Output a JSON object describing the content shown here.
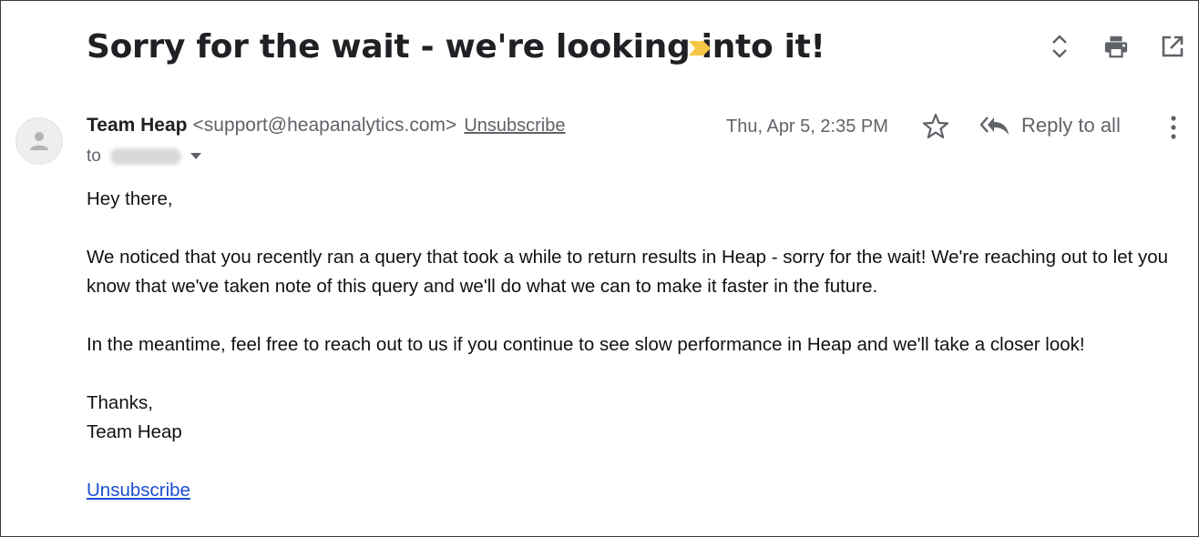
{
  "email": {
    "subject": "Sorry for the wait - we're looking into it!",
    "importance_marker_color": "#f6c744",
    "sender": {
      "name": "Team Heap",
      "email": "<support@heapanalytics.com>",
      "unsubscribe_label": "Unsubscribe"
    },
    "to_label": "to",
    "date": "Thu, Apr 5, 2:35 PM",
    "reply_all_label": "Reply to all",
    "body": {
      "greeting": "Hey there,",
      "paragraph1": "We noticed that you recently ran a query that took a while to return results in Heap - sorry for the wait! We're reaching out to let you know that we've taken note of this query and we'll do what we can to make it faster in the future.",
      "paragraph2": "In the meantime, feel free to reach out to us if you continue to see slow performance in Heap and we'll take a closer look!",
      "signoff": "Thanks,",
      "signature": "Team Heap",
      "unsubscribe_link": "Unsubscribe"
    }
  },
  "icons": {
    "expand": "unfold-icon",
    "print": "print-icon",
    "open_new": "open-in-new-window-icon",
    "avatar": "default-avatar-icon",
    "star": "star-icon",
    "reply_all": "reply-all-icon",
    "more": "more-vertical-icon"
  }
}
